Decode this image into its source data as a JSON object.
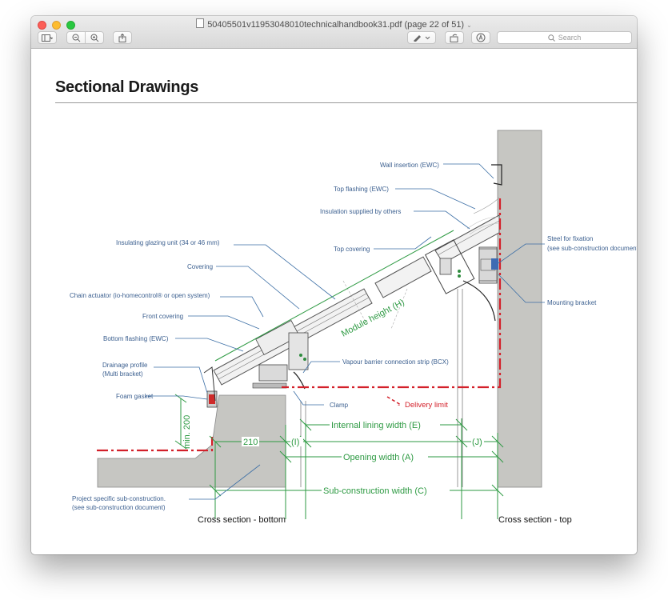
{
  "window": {
    "title": "50405501v11953048010technicalhandbook31.pdf (page 22 of 51)",
    "search_placeholder": "Search"
  },
  "page": {
    "heading": "Sectional Drawings"
  },
  "drawing": {
    "labels": {
      "wall_insertion": "Wall insertion (EWC)",
      "top_flashing": "Top flashing (EWC)",
      "insulation": "Insulation supplied by others",
      "top_covering": "Top covering",
      "steel_fixation_1": "Steel for fixation",
      "steel_fixation_2": "(see sub-construction document)",
      "mounting_bracket": "Mounting bracket",
      "insulating_glazing": "Insulating glazing unit (34 or 46 mm)",
      "covering": "Covering",
      "chain_actuator": "Chain actuator (io-homecontrol® or open system)",
      "front_covering": "Front covering",
      "bottom_flashing": "Bottom flashing (EWC)",
      "drainage_1": "Drainage profile",
      "drainage_2": "(Multi bracket)",
      "foam_gasket": "Foam gasket",
      "vapour_barrier": "Vapour barrier connection strip (BCX)",
      "clamp": "Clamp",
      "delivery_limit": "Delivery limit",
      "project_sub_1": "Project specific sub-construction.",
      "project_sub_2": "(see sub-construction document)"
    },
    "dimensions": {
      "module_height": "Module height (H)",
      "internal_lining": "Internal lining width (E)",
      "opening_width": "Opening width (A)",
      "sub_construction": "Sub-construction width (C)",
      "min_200": "min. 200",
      "d210": "210",
      "i": "(I)",
      "j": "(J)"
    },
    "captions": {
      "bottom": "Cross section - bottom",
      "top": "Cross section - top"
    }
  }
}
